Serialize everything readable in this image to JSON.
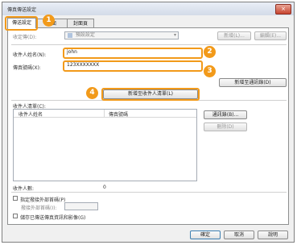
{
  "window": {
    "title": "傳真傳送設定",
    "close_icon": "×"
  },
  "tabs": [
    "傳送設定",
    "頁面",
    "封面頁"
  ],
  "callouts": [
    "1",
    "2",
    "3",
    "4"
  ],
  "dialog": {
    "address_book_label": "收定傳(D):",
    "address_book_value": "預設設定",
    "add_button": "新增(L)...",
    "edit_button": "編輯(E)...",
    "recipient_name_label": "收件人姓名(N):",
    "recipient_name_value": "john",
    "fax_number_label": "傳真號碼(X):",
    "fax_number_value": "123XXXXXXX",
    "add_to_book_button": "新增至通訊錄(D)",
    "add_recipient_button": "新增至收件人清單(L)",
    "recipient_list_label": "收件人清單(C):",
    "columns": [
      "收件人姓名",
      "傳真號碼"
    ],
    "address_book_button": "通訊錄(B)...",
    "delete_button": "刪除(D)",
    "recipient_count_label": "收件人數:",
    "recipient_count_value": "0",
    "outside_line_label": "指定撥接外部首碼(P)",
    "outside_line_prefix_label": "撥接外部首碼(I):",
    "save_info_label": "儲存已傳送傳真資訊和影像(G)"
  },
  "footer": {
    "ok": "確定",
    "cancel": "取消",
    "help": "說明"
  }
}
